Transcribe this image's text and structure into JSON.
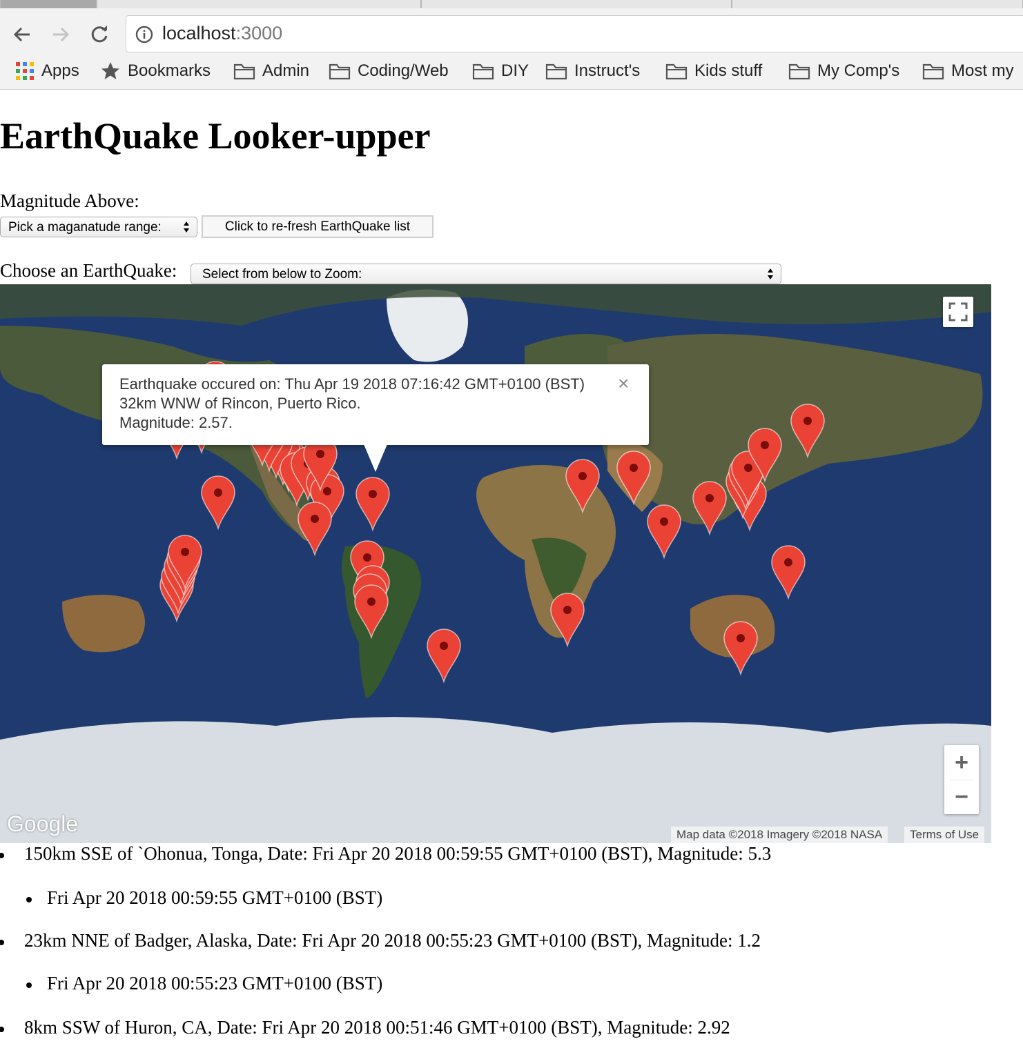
{
  "browser": {
    "url_host": "localhost",
    "url_port": ":3000",
    "bookmarks": [
      "Apps",
      "Bookmarks",
      "Admin",
      "Coding/Web",
      "DIY",
      "Instruct's",
      "Kids stuff",
      "My Comp's",
      "Most my"
    ]
  },
  "page": {
    "title": "EarthQuake Looker-upper",
    "magnitude_label": "Magnitude Above:",
    "magnitude_select": "Pick a maganatude range:",
    "refresh_button": "Click to re-fresh EarthQuake list",
    "choose_label": "Choose an EarthQuake:",
    "quake_select": "Select from below to Zoom:"
  },
  "map": {
    "google_logo": "Google",
    "attribution": "Map data ©2018 Imagery ©2018 NASA",
    "terms": "Terms of Use",
    "zoom_in": "+",
    "zoom_out": "−",
    "marker_color": "#ea4335",
    "ocean_color": "#1f3a6e",
    "infowindow": {
      "line1": "Earthquake occured on: Thu Apr 19 2018 07:16:42 GMT+0100 (BST)",
      "line2": "32km WNW of Rincon, Puerto Rico.",
      "line3": "Magnitude: 2.57.",
      "close": "×"
    }
  },
  "quakes": [
    {
      "summary": "150km SSE of `Ohonua, Tonga, Date: Fri Apr 20 2018 00:59:55 GMT+0100 (BST), Magnitude: 5.3",
      "date": "Fri Apr 20 2018 00:59:55 GMT+0100 (BST)"
    },
    {
      "summary": "23km NNE of Badger, Alaska, Date: Fri Apr 20 2018 00:55:23 GMT+0100 (BST), Magnitude: 1.2",
      "date": "Fri Apr 20 2018 00:55:23 GMT+0100 (BST)"
    },
    {
      "summary": "8km SSW of Huron, CA, Date: Fri Apr 20 2018 00:51:46 GMT+0100 (BST), Magnitude: 2.92"
    }
  ]
}
